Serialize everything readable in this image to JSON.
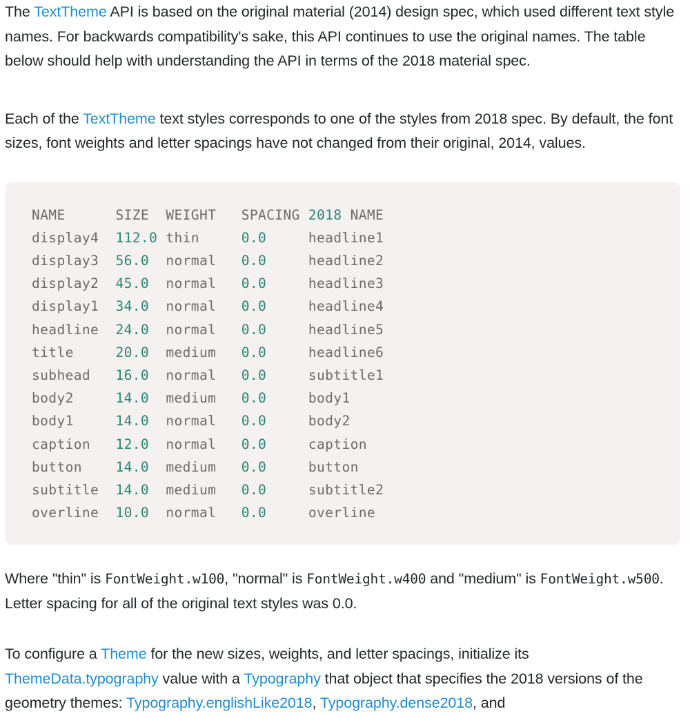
{
  "page": {
    "link_color": "#1f8ccc",
    "code_value_color": "#2c8577",
    "code_text_color": "#6b6b6b",
    "code_background": "#f5f1f0",
    "body_text_color": "#22272b"
  },
  "paragraph_1": {
    "t1": "The ",
    "link1": "TextTheme",
    "t2": " API is based on the original material (2014) design spec, which used different text style names. For backwards compatibility's sake, this API continues to use the original names. The table below should help with understanding the API in terms of the 2018 material spec."
  },
  "paragraph_2": {
    "t1": "Each of the ",
    "link1": "TextTheme",
    "t2": " text styles corresponds to one of the styles from 2018 spec. By default, the font sizes, font weights and letter spacings have not changed from their original, 2014, values."
  },
  "paragraph_3": {
    "t1": "Where \"thin\" is ",
    "code1": "FontWeight.w100",
    "t2": ", \"normal\" is ",
    "code2": "FontWeight.w400",
    "t3": " and \"medium\" is ",
    "code3": "FontWeight.w500",
    "t4": ". Letter spacing for all of the original text styles was 0.0."
  },
  "paragraph_4": {
    "t1": "To configure a ",
    "link1": "Theme",
    "t2": " for the new sizes, weights, and letter spacings, initialize its ",
    "link2": "ThemeData.typography",
    "t3": " value with a ",
    "link3": "Typography",
    "t4": " that object that specifies the 2018 versions of the geometry themes: ",
    "link4": "Typography.englishLike2018",
    "t5": ", ",
    "link5": "Typography.dense2018",
    "t6": ", and"
  },
  "chart_data": {
    "type": "table",
    "title": "TextTheme 2014 to 2018 style mapping",
    "columns": [
      "NAME",
      "SIZE",
      "WEIGHT",
      "SPACING",
      "2018 NAME"
    ],
    "header_highlight": {
      "col_index": 4,
      "highlighted_token": "2018"
    },
    "rows": [
      {
        "name": "display4",
        "size": "112.0",
        "weight": "thin",
        "spacing": "0.0",
        "name2018": "headline1"
      },
      {
        "name": "display3",
        "size": "56.0",
        "weight": "normal",
        "spacing": "0.0",
        "name2018": "headline2"
      },
      {
        "name": "display2",
        "size": "45.0",
        "weight": "normal",
        "spacing": "0.0",
        "name2018": "headline3"
      },
      {
        "name": "display1",
        "size": "34.0",
        "weight": "normal",
        "spacing": "0.0",
        "name2018": "headline4"
      },
      {
        "name": "headline",
        "size": "24.0",
        "weight": "normal",
        "spacing": "0.0",
        "name2018": "headline5"
      },
      {
        "name": "title",
        "size": "20.0",
        "weight": "medium",
        "spacing": "0.0",
        "name2018": "headline6"
      },
      {
        "name": "subhead",
        "size": "16.0",
        "weight": "normal",
        "spacing": "0.0",
        "name2018": "subtitle1"
      },
      {
        "name": "body2",
        "size": "14.0",
        "weight": "medium",
        "spacing": "0.0",
        "name2018": "body1"
      },
      {
        "name": "body1",
        "size": "14.0",
        "weight": "normal",
        "spacing": "0.0",
        "name2018": "body2"
      },
      {
        "name": "caption",
        "size": "12.0",
        "weight": "normal",
        "spacing": "0.0",
        "name2018": "caption"
      },
      {
        "name": "button",
        "size": "14.0",
        "weight": "medium",
        "spacing": "0.0",
        "name2018": "button"
      },
      {
        "name": "subtitle",
        "size": "14.0",
        "weight": "medium",
        "spacing": "0.0",
        "name2018": "subtitle2"
      },
      {
        "name": "overline",
        "size": "10.0",
        "weight": "normal",
        "spacing": "0.0",
        "name2018": "overline"
      }
    ]
  }
}
